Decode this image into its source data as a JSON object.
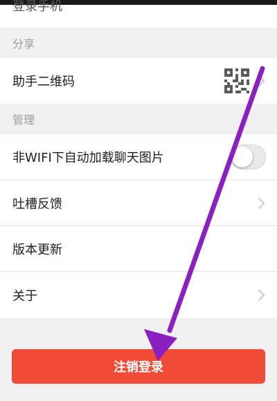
{
  "top_row": {
    "label": "登录手机"
  },
  "sections": {
    "share": {
      "header": "分享"
    },
    "manage": {
      "header": "管理"
    }
  },
  "rows": {
    "qr_code": {
      "label": "助手二维码",
      "icon": "qr-code-icon"
    },
    "auto_load_images": {
      "label": "非WIFI下自动加载聊天图片",
      "toggle_on": false
    },
    "feedback": {
      "label": "吐槽反馈",
      "icon": "chevron-right-icon"
    },
    "update": {
      "label": "版本更新"
    },
    "about": {
      "label": "关于",
      "icon": "chevron-right-icon"
    }
  },
  "logout_button": {
    "label": "注销登录",
    "color": "#f14b37"
  },
  "annotation": {
    "type": "arrow",
    "color": "#8b1fbf",
    "icon": "arrow-down-left-icon"
  }
}
